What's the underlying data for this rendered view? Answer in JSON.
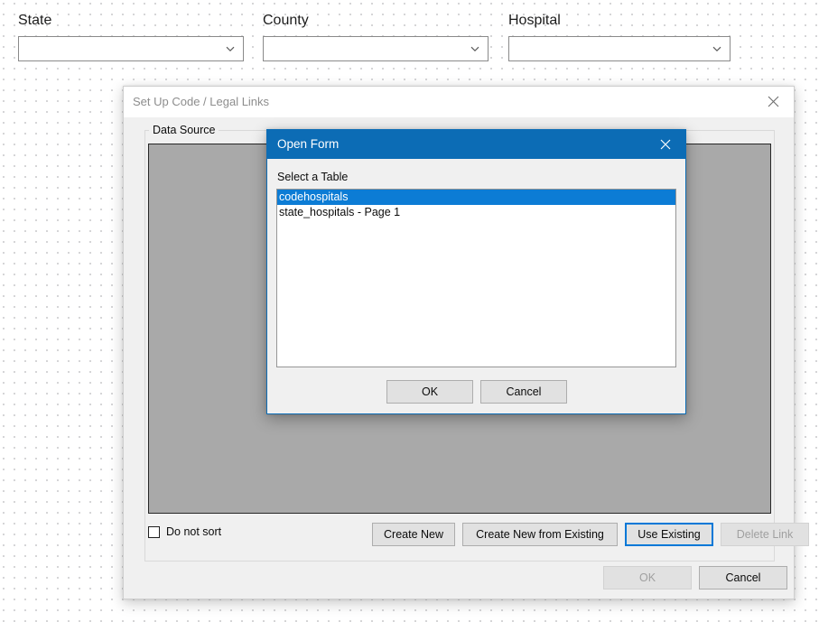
{
  "designer": {
    "fields": [
      {
        "label": "State",
        "value": "",
        "placeholder": ""
      },
      {
        "label": "County",
        "value": "",
        "placeholder": ""
      },
      {
        "label": "Hospital",
        "value": "",
        "placeholder": ""
      }
    ],
    "dropdown_icon": "chevron-down-icon"
  },
  "outer_window": {
    "title": "Set Up Code / Legal Links",
    "close_icon": "close-icon",
    "groupbox": {
      "legend": "Data Source"
    },
    "do_not_sort": {
      "label": "Do not sort",
      "checked": false
    },
    "buttons": [
      {
        "label": "Create New",
        "enabled": true,
        "focused": false
      },
      {
        "label": "Create New from Existing",
        "enabled": true,
        "focused": false
      },
      {
        "label": "Use Existing",
        "enabled": true,
        "focused": true
      },
      {
        "label": "Delete Link",
        "enabled": false,
        "focused": false
      }
    ],
    "footer_buttons": [
      {
        "label": "OK",
        "enabled": false
      },
      {
        "label": "Cancel",
        "enabled": true
      }
    ]
  },
  "dialog": {
    "title": "Open Form",
    "close_icon": "close-icon",
    "body_label": "Select a Table",
    "list_items": [
      {
        "label": "codehospitals",
        "selected": true
      },
      {
        "label": "state_hospitals - Page 1",
        "selected": false
      }
    ],
    "buttons": [
      {
        "label": "OK",
        "enabled": true
      },
      {
        "label": "Cancel",
        "enabled": true
      }
    ]
  },
  "colors": {
    "dialog_titlebar": "#0c6cb5",
    "selection": "#0c7cd5",
    "focus_border": "#0078d7",
    "panel_grey": "#a9a9a9",
    "window_chrome": "#f0f0f0"
  }
}
